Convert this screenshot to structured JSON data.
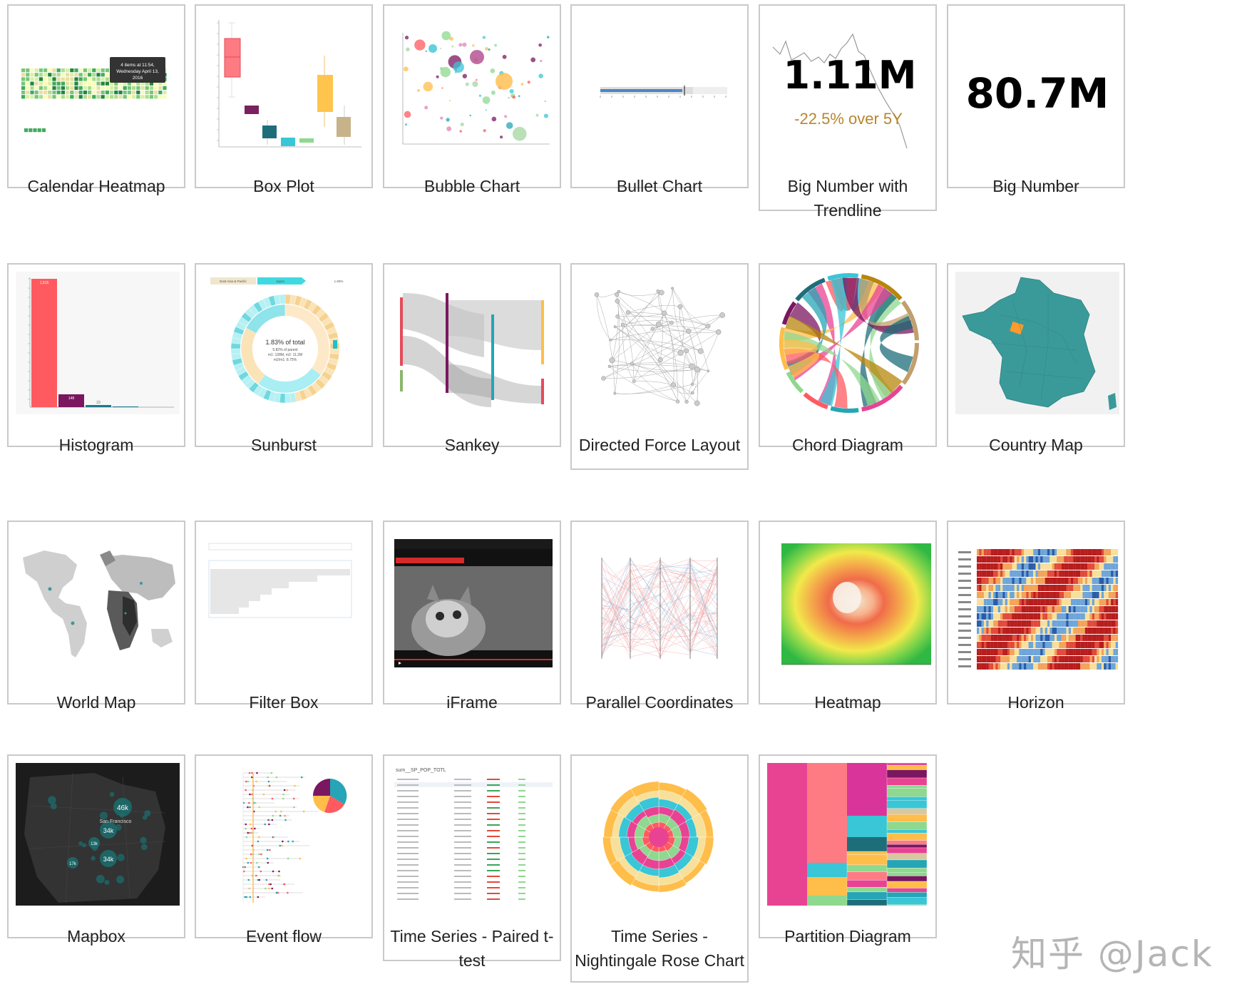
{
  "gallery": {
    "cards": [
      {
        "label": "Calendar Heatmap"
      },
      {
        "label": "Box Plot"
      },
      {
        "label": "Bubble Chart"
      },
      {
        "label": "Bullet Chart"
      },
      {
        "label": "Big Number with Trendline"
      },
      {
        "label": "Big Number"
      },
      {
        "label": "Histogram"
      },
      {
        "label": "Sunburst"
      },
      {
        "label": "Sankey"
      },
      {
        "label": "Directed Force Layout"
      },
      {
        "label": "Chord Diagram"
      },
      {
        "label": "Country Map"
      },
      {
        "label": "World Map"
      },
      {
        "label": "Filter Box"
      },
      {
        "label": "iFrame"
      },
      {
        "label": "Parallel Coordinates"
      },
      {
        "label": "Heatmap"
      },
      {
        "label": "Horizon"
      },
      {
        "label": "Mapbox"
      },
      {
        "label": "Event flow"
      },
      {
        "label": "Time Series - Paired t-test"
      },
      {
        "label": "Time Series - Nightingale Rose Chart"
      },
      {
        "label": "Partition Diagram"
      }
    ]
  },
  "thumbnails": {
    "calendar_tooltip": [
      "4 items at 11:54,",
      "Wednesday April 13,",
      "2016"
    ],
    "big_number_trendline": {
      "value": "1.11M",
      "change": "-22.5% over 5Y"
    },
    "big_number": {
      "value": "80.7M"
    },
    "histogram_labels": [
      "1,515",
      "148",
      "23"
    ],
    "sunburst": {
      "center": "1.83% of total",
      "sub": "5.82% of parent",
      "line3": "m1: 128M, m2: 11.2M",
      "line4": "m2/m1: 8.75%",
      "crumb1": "East Asia & Pacific",
      "crumb2": "Japan",
      "crumb3": "1.83%"
    },
    "mapbox_clusters": [
      "46k",
      "34k",
      "34k",
      "13k",
      "17k"
    ],
    "mapbox_city": "San Francisco",
    "paired_ttest_metric": "sum__SP_POP_TOTL"
  },
  "colors": {
    "card_border": "#c9c9c9",
    "teal": "#3a9a9a",
    "red": "#ff5a5f",
    "watermark": "#b5b5b5"
  },
  "watermark": "知乎 @Jack"
}
